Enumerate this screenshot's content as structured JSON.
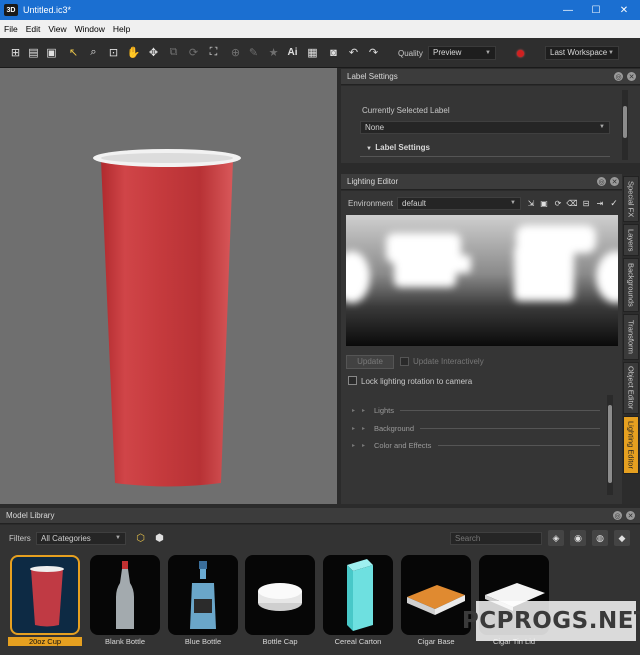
{
  "window": {
    "title": "Untitled.ic3*",
    "app_icon": "3D",
    "controls": [
      "—",
      "☐",
      "✕"
    ]
  },
  "menu": [
    "File",
    "Edit",
    "View",
    "Window",
    "Help"
  ],
  "toolbar": {
    "quality_label": "Quality",
    "quality_value": "Preview",
    "workspace_value": "Last Workspace",
    "text_tool": "Ai"
  },
  "label_settings": {
    "title": "Label Settings",
    "currently_selected_label": "Currently Selected Label",
    "selected_value": "None",
    "section": "Label Settings"
  },
  "lighting_editor": {
    "title": "Lighting Editor",
    "environment_label": "Environment",
    "environment_value": "default",
    "update_button": "Update",
    "update_interactively": "Update Interactively",
    "lock_rotation": "Lock lighting rotation to camera",
    "sections": [
      "Lights",
      "Background",
      "Color and Effects"
    ]
  },
  "side_tabs": [
    "Special FX",
    "Layers",
    "Backgrounds",
    "Transform",
    "Object Editor",
    "Lighting Editor"
  ],
  "model_library": {
    "title": "Model Library",
    "filters_label": "Filters",
    "category_value": "All Categories",
    "search_placeholder": "Search",
    "items": [
      "20oz Cup",
      "Blank Bottle",
      "Blue Bottle",
      "Bottle Cap",
      "Cereal Carton",
      "Cigar Base",
      "Cigar Tin Lid"
    ]
  },
  "watermark": "PCPROGS.NET",
  "colors": {
    "title_bar": "#1b6fd1",
    "accent": "#e6a020",
    "cup_red": "#c83a3c"
  }
}
